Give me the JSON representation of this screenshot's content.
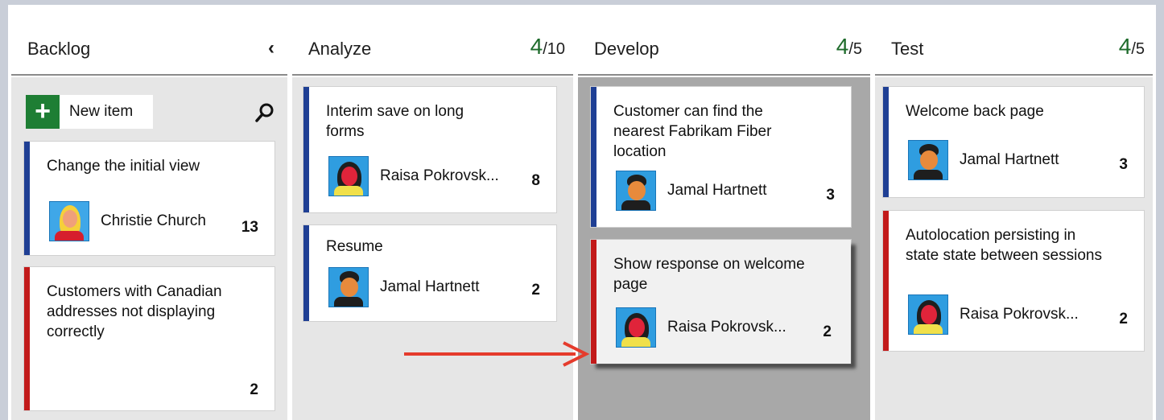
{
  "columns": {
    "backlog": {
      "title": "Backlog",
      "new_item_label": "New item",
      "cards": [
        {
          "title": "Change the initial view",
          "assignee": "Christie Church",
          "effort": "13",
          "type": "story"
        },
        {
          "title": "Customers with Canadian addresses not displaying correctly",
          "assignee": "",
          "effort": "2",
          "type": "bug"
        }
      ]
    },
    "analyze": {
      "title": "Analyze",
      "wip_count": "4",
      "wip_limit": "/10",
      "cards": [
        {
          "title": "Interim save on long forms",
          "assignee": "Raisa Pokrovsk...",
          "effort": "8",
          "type": "story"
        },
        {
          "title": "Resume",
          "assignee": "Jamal Hartnett",
          "effort": "2",
          "type": "story"
        }
      ]
    },
    "develop": {
      "title": "Develop",
      "wip_count": "4",
      "wip_limit": "/5",
      "cards": [
        {
          "title": "Customer can find the nearest Fabrikam Fiber location",
          "assignee": "Jamal Hartnett",
          "effort": "3",
          "type": "story"
        },
        {
          "title": "Show response on welcome page",
          "assignee": "Raisa Pokrovsk...",
          "effort": "2",
          "type": "bug"
        }
      ]
    },
    "test": {
      "title": "Test",
      "wip_count": "4",
      "wip_limit": "/5",
      "cards": [
        {
          "title": "Welcome back page",
          "assignee": "Jamal Hartnett",
          "effort": "3",
          "type": "story"
        },
        {
          "title": "Autolocation persisting in state state between sessions",
          "assignee": "Raisa Pokrovsk...",
          "effort": "2",
          "type": "bug"
        }
      ]
    }
  },
  "icons": {
    "collapse": "chevron-left-icon",
    "search": "search-icon",
    "add": "plus-icon",
    "drag_indicator": "red-arrow"
  },
  "colors": {
    "story_accent": "#1f3f94",
    "bug_accent": "#c21a1a",
    "wip_ok": "#1e6b2b",
    "new_item_button": "#1e7e34",
    "drop_target": "#a8a8a8",
    "arrow": "#e53b2c"
  }
}
